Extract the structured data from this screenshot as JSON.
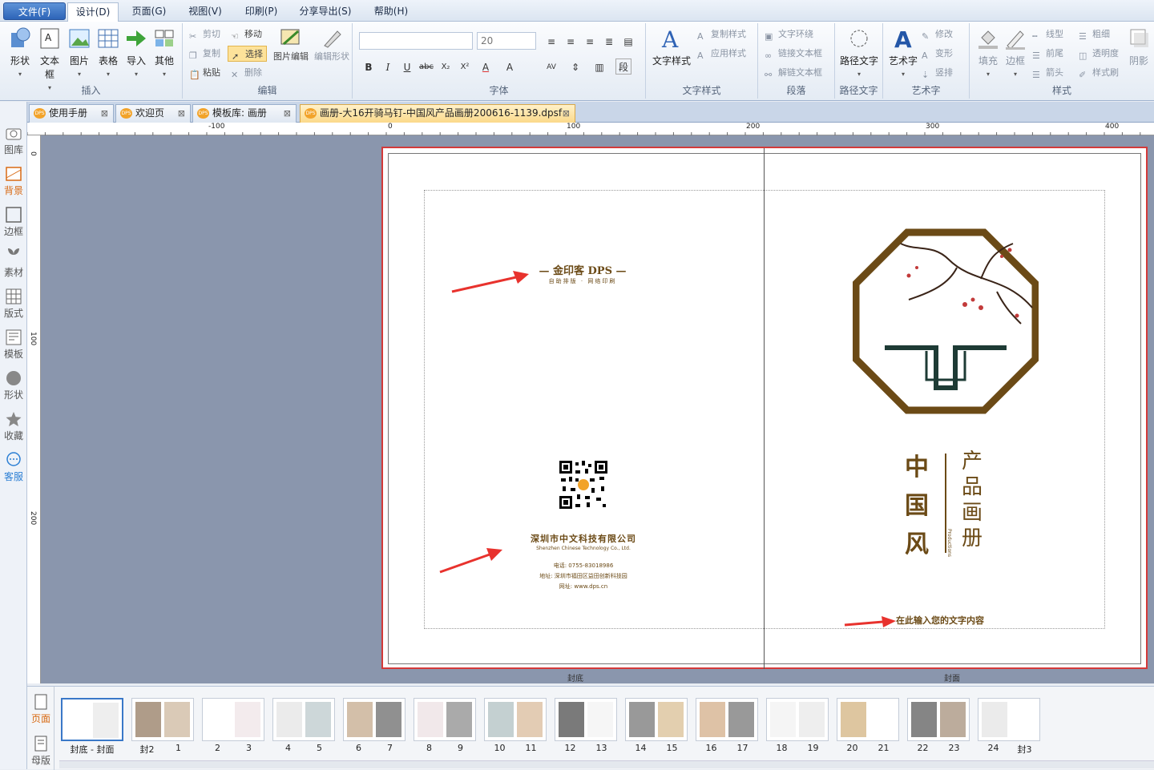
{
  "menubar": {
    "file": "文件(F)",
    "items": [
      "设计(D)",
      "页面(G)",
      "视图(V)",
      "印刷(P)",
      "分享导出(S)",
      "帮助(H)"
    ]
  },
  "ribbon": {
    "insert": {
      "label": "插入",
      "buttons": [
        "形状",
        "文本框",
        "图片",
        "表格",
        "导入",
        "其他"
      ]
    },
    "edit": {
      "label": "编辑",
      "cut": "剪切",
      "move": "移动",
      "copy": "复制",
      "select": "选择",
      "paste": "粘贴",
      "delete": "删除",
      "image_edit": "图片编辑",
      "edit_shape": "编辑形状"
    },
    "font": {
      "label": "字体",
      "font_name": "",
      "font_size": "20"
    },
    "text_style": {
      "label": "文字样式",
      "button": "文字样式",
      "copy_style": "复制样式",
      "apply_style": "应用样式"
    },
    "paragraph": {
      "label": "段落",
      "wrap": "文字环绕",
      "link": "链接文本框",
      "unlink": "解链文本框"
    },
    "path_text": {
      "label": "路径文字",
      "button": "路径文字"
    },
    "art_text": {
      "label": "艺术字",
      "button": "艺术字",
      "modify": "修改",
      "transform": "变形",
      "vertical": "竖排"
    },
    "style": {
      "label": "样式",
      "fill": "填充",
      "border": "边框",
      "line_type": "线型",
      "weight": "粗细",
      "front_end": "前尾",
      "opacity": "透明度",
      "arrow": "箭头",
      "brush": "样式刷",
      "shadow": "阴影"
    }
  },
  "tabs": [
    {
      "label": "使用手册",
      "icon": "dps-icon"
    },
    {
      "label": "欢迎页",
      "icon": "dps-icon"
    },
    {
      "label": "模板库: 画册",
      "icon": "dps-icon"
    },
    {
      "label": "画册-大16开骑马钉-中国风产品画册200616-1139.dpsf",
      "icon": "dps-icon"
    }
  ],
  "leftbar": [
    "图库",
    "背景",
    "边框",
    "素材",
    "版式",
    "模板",
    "形状",
    "收藏",
    "客服"
  ],
  "ruler": {
    "marks": [
      "-100",
      "0",
      "100",
      "200",
      "300",
      "400"
    ],
    "v_marks": [
      "0",
      "100",
      "200"
    ]
  },
  "page": {
    "back_cover": {
      "logo": "— 金印客 DPS —",
      "tagline": "自助排版 · 网络印刷",
      "company": "深圳市中文科技有限公司",
      "company_en": "Shenzhen Chinese Technology Co., Ltd.",
      "phone": "电话: 0755-83018986",
      "address": "地址: 深圳市福田区益田创新科技园",
      "website": "网址: www.dps.cn",
      "label": "封底"
    },
    "front_cover": {
      "title_left": "中国风",
      "title_right": "产品画册",
      "subtitle": "Productions",
      "input_hint": "在此输入您的文字内容",
      "label": "封面"
    }
  },
  "thumbs": {
    "side": [
      "页面",
      "母版"
    ],
    "pages": [
      "封底 - 封面",
      "封2",
      "1",
      "2",
      "3",
      "4",
      "5",
      "6",
      "7",
      "8",
      "9",
      "10",
      "11",
      "12",
      "13",
      "14",
      "15",
      "16",
      "17",
      "18",
      "19",
      "20",
      "21",
      "22",
      "23",
      "24",
      "封3"
    ]
  },
  "colors": {
    "accent": "#2d64b8",
    "cover_brown": "#6b4a16",
    "arrow_red": "#e8322d",
    "border_red": "#d43a3a"
  }
}
